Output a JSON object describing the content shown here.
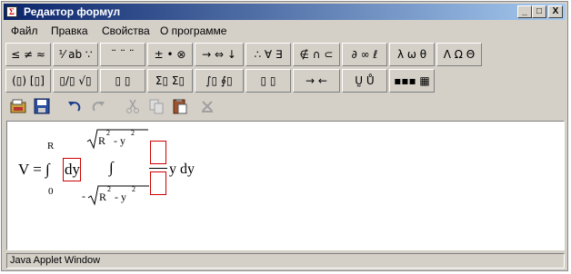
{
  "window": {
    "title": "Редактор формул",
    "controls": {
      "minimize": "_",
      "maximize": "□",
      "close": "X"
    }
  },
  "menu": [
    "Файл",
    "Правка",
    "Свойства",
    "О программе"
  ],
  "palette": {
    "row1": [
      "≤ ≠ ≈",
      "⅟ ab ∵",
      "¨ ¨ ¨",
      "± • ⊗",
      "→ ⇔ ↓",
      "∴ ∀ ∃",
      "∉ ∩ ⊂",
      "∂ ∞ ℓ",
      "λ ω θ",
      "Λ Ω Θ"
    ],
    "row2": [
      "(▯) [▯]",
      "▯/▯ √▯",
      "▯ ▯",
      "Σ▯ Σ▯",
      "∫▯ ∮▯",
      "▯ ▯",
      "→ ←",
      "Ṵ Ů",
      "▪▪▪ ▦"
    ]
  },
  "toolbar": {
    "open": "open-icon",
    "save": "save-icon",
    "undo": "undo-icon",
    "redo": "redo-icon",
    "cut": "cut-icon",
    "copy": "copy-icon",
    "paste": "paste-icon",
    "clear": "clear-icon"
  },
  "formula": {
    "lhs": "V = ∫",
    "upper_limit": "R",
    "lower_limit": "0",
    "box_dy": "dy",
    "inner_integral": "∫",
    "radical_upper": "R",
    "radical_upper_exp": "2",
    "radical_upper_minus": "- y",
    "radical_upper_exp2": "2",
    "minus_sign": "-",
    "radical_lower": "R",
    "radical_lower_exp": "2",
    "radical_lower_minus": "- y",
    "radical_lower_exp2": "2",
    "tail": "y dy"
  },
  "status": {
    "text": "Java Applet Window"
  }
}
